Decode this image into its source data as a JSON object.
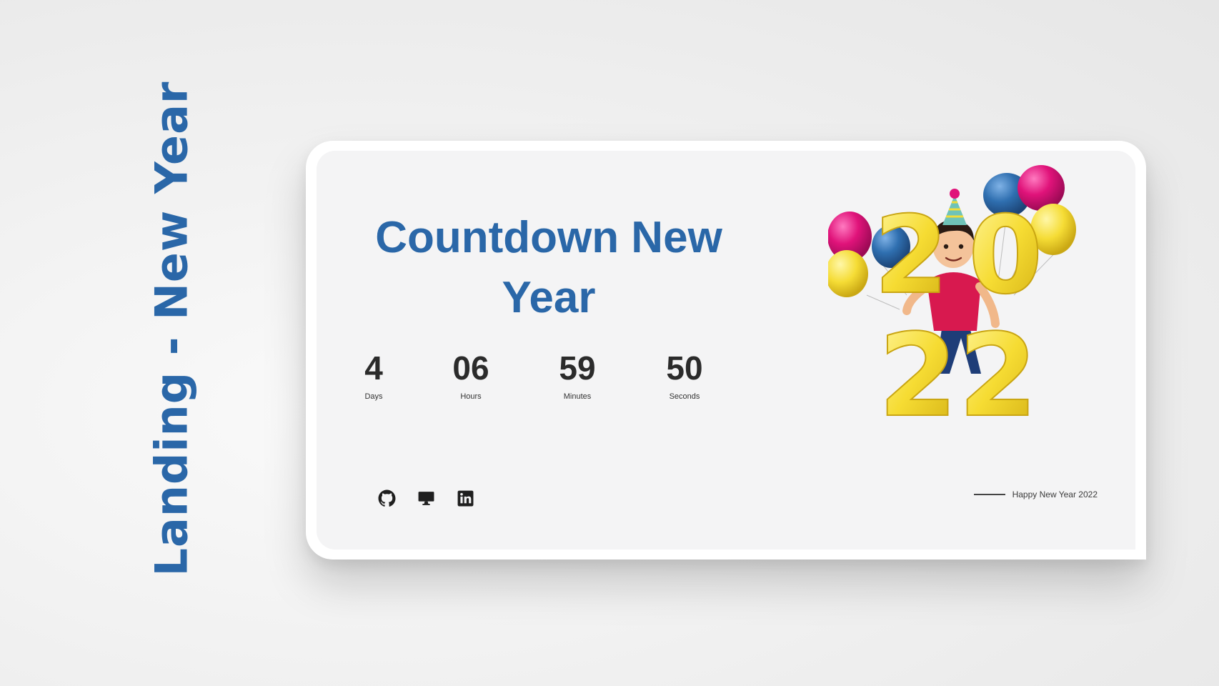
{
  "side_title": "Landing - New Year",
  "card": {
    "headline": "Countdown New Year",
    "countdown": [
      {
        "value": "4",
        "label": "Days"
      },
      {
        "value": "06",
        "label": "Hours"
      },
      {
        "value": "59",
        "label": "Minutes"
      },
      {
        "value": "50",
        "label": "Seconds"
      }
    ],
    "social_icons": [
      "github-icon",
      "desktop-monitor-icon",
      "linkedin-icon"
    ],
    "tagline": "Happy New Year 2022",
    "illustration": {
      "year_digits": [
        "2",
        "0",
        "2",
        "2"
      ],
      "balloon_colors": [
        "#e0137a",
        "#2f6fb0",
        "#f2dc3a"
      ]
    }
  },
  "colors": {
    "accent": "#2a67a8",
    "numbers": "#2b2b2b",
    "card_bg": "#f4f4f5",
    "balloon_yellow": "#f5dc35"
  }
}
